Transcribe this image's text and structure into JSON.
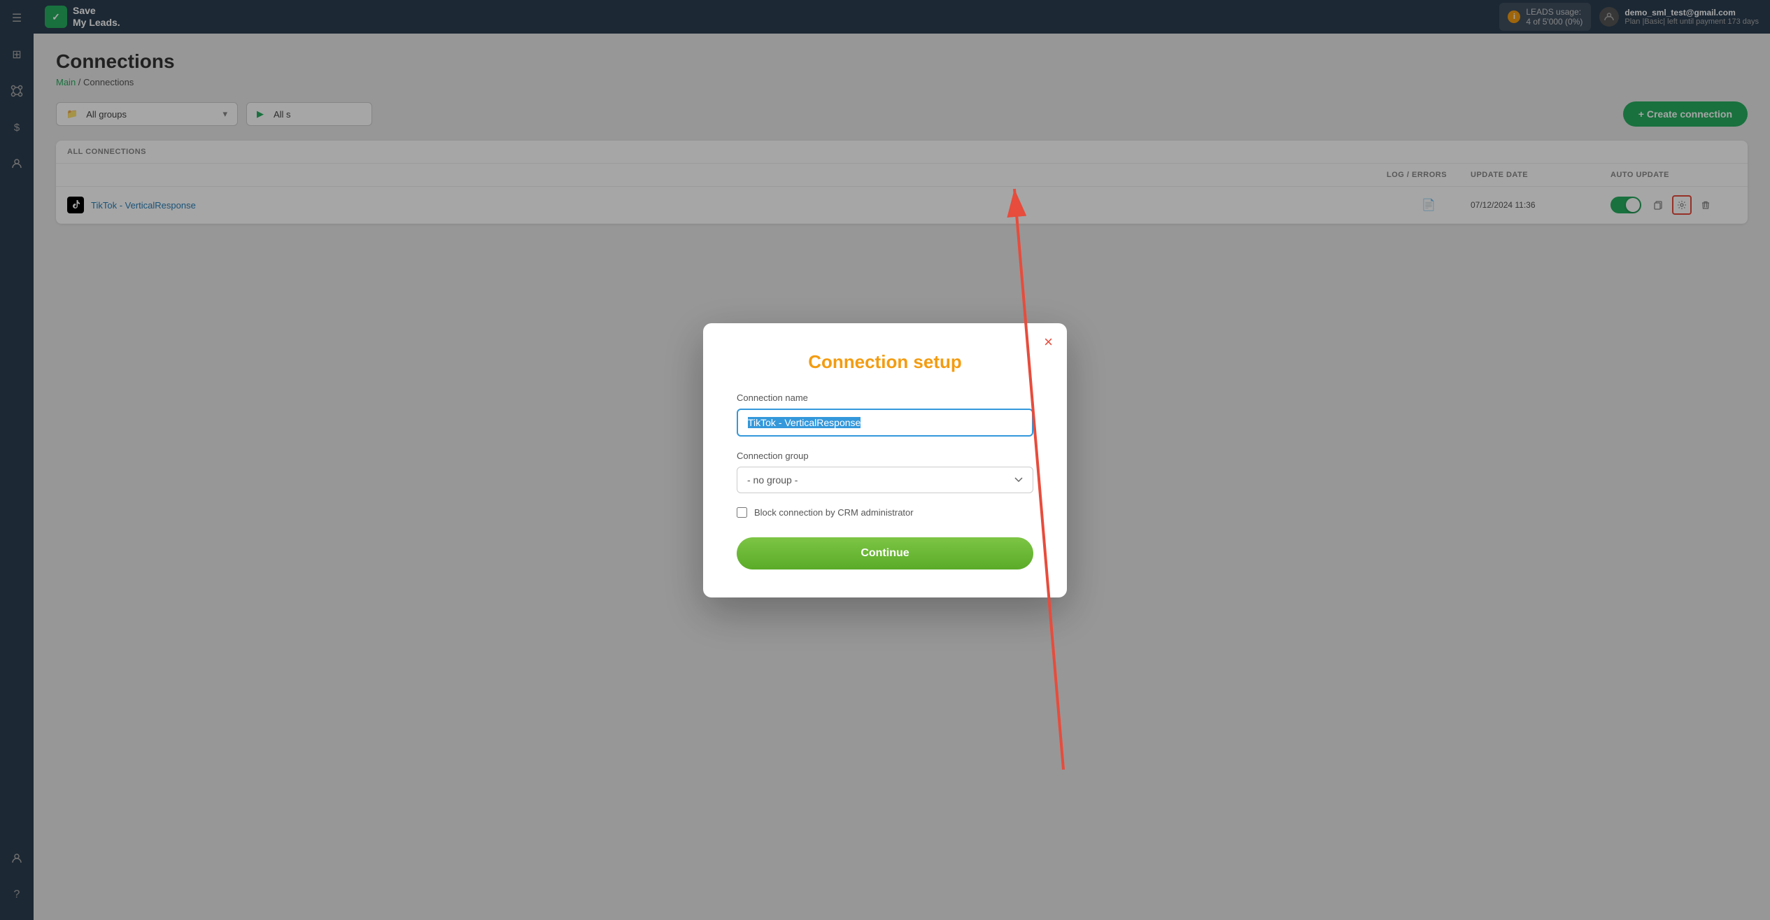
{
  "app": {
    "name": "Save\nMy Leads.",
    "logo_check": "✓"
  },
  "header": {
    "leads_label": "LEADS usage:",
    "leads_usage": "4 of 5'000 (0%)",
    "user_email": "demo_sml_test@gmail.com",
    "user_plan": "Plan |Basic| left until payment 173 days"
  },
  "sidebar": {
    "items": [
      {
        "icon": "☰",
        "name": "menu"
      },
      {
        "icon": "⊞",
        "name": "dashboard"
      },
      {
        "icon": "≡",
        "name": "connections"
      },
      {
        "icon": "$",
        "name": "billing"
      },
      {
        "icon": "👥",
        "name": "users"
      },
      {
        "icon": "👤",
        "name": "profile"
      },
      {
        "icon": "?",
        "name": "help"
      }
    ]
  },
  "page": {
    "title": "Connections",
    "breadcrumb_main": "Main",
    "breadcrumb_separator": " / ",
    "breadcrumb_current": "Connections"
  },
  "toolbar": {
    "group_icon": "📁",
    "group_label": "All groups",
    "group_chevron": "▾",
    "status_icon": "▶",
    "status_label": "All s",
    "create_label": "+ Create connection"
  },
  "table": {
    "section_label": "ALL CONNECTIONS",
    "columns": {
      "log_errors": "LOG / ERRORS",
      "update_date": "UPDATE DATE",
      "auto_update": "AUTO UPDATE"
    },
    "rows": [
      {
        "name": "TikTok - VerticalResponse",
        "log_value": "📄",
        "update_date": "07/12/2024 11:36",
        "auto_update": true
      }
    ]
  },
  "modal": {
    "title": "Connection setup",
    "close_label": "×",
    "name_label": "Connection name",
    "name_value": "TikTok - VerticalResponse",
    "group_label": "Connection group",
    "group_placeholder": "- no group -",
    "group_options": [
      "- no group -"
    ],
    "block_label": "Block connection by CRM administrator",
    "continue_label": "Continue"
  }
}
